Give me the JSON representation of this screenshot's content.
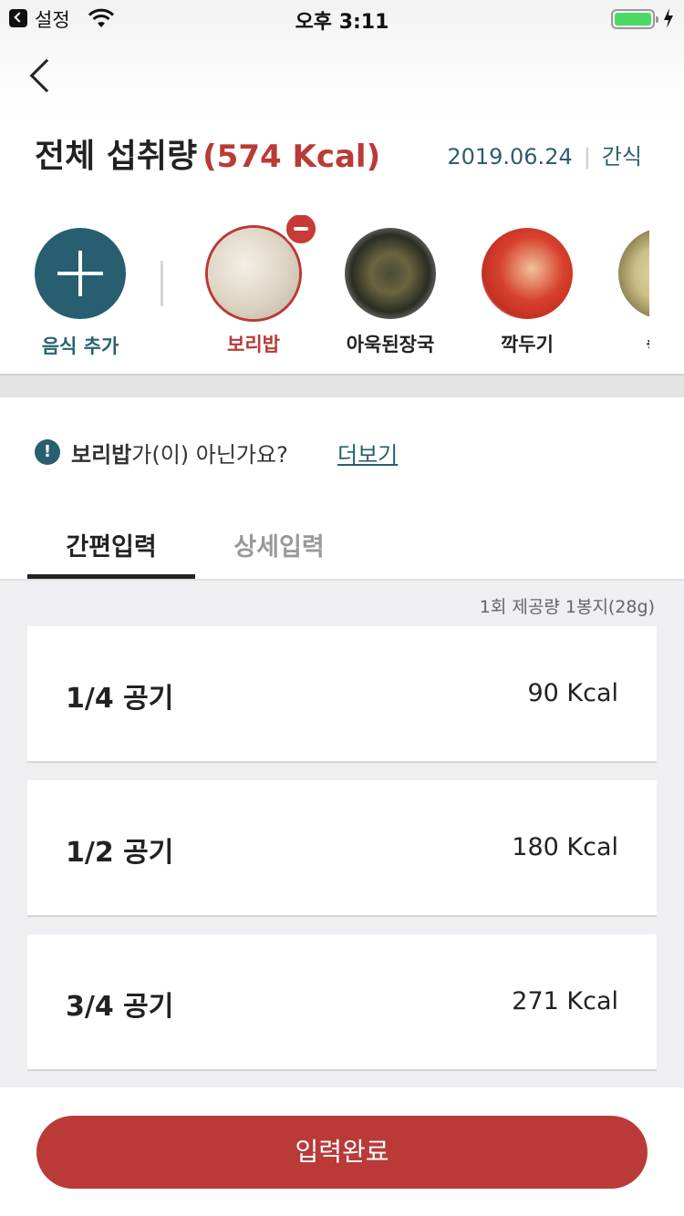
{
  "status_bar": {
    "back_app": "설정",
    "time": "오후 3:11"
  },
  "header": {
    "title": "전체 섭취량",
    "total_kcal": "(574 Kcal)",
    "date": "2019.06.24",
    "meal": "간식"
  },
  "food_strip": {
    "add_label": "음식 추가",
    "items": [
      {
        "name": "보리밥",
        "selected": true,
        "icon": "barley-rice-photo"
      },
      {
        "name": "아욱된장국",
        "selected": false,
        "icon": "mallow-soybean-soup-photo"
      },
      {
        "name": "깍두기",
        "selected": false,
        "icon": "radish-kimchi-photo"
      },
      {
        "name": "숙주",
        "selected": false,
        "icon": "bean-sprouts-photo"
      }
    ]
  },
  "notice": {
    "icon": "!",
    "food_name": "보리밥",
    "text": "가(이) 아닌가요?",
    "link": "더보기"
  },
  "tabs": [
    {
      "label": "간편입력",
      "active": true
    },
    {
      "label": "상세입력",
      "active": false
    }
  ],
  "serving_info": "1회 제공량  1봉지(28g)",
  "portions": [
    {
      "label": "1/4 공기",
      "kcal": "90 Kcal"
    },
    {
      "label": "1/2 공기",
      "kcal": "180 Kcal"
    },
    {
      "label": "3/4 공기",
      "kcal": "271 Kcal"
    }
  ],
  "submit_label": "입력완료",
  "colors": {
    "accent_red": "#b93a37",
    "accent_teal": "#275f70",
    "list_bg": "#eeeef3"
  }
}
